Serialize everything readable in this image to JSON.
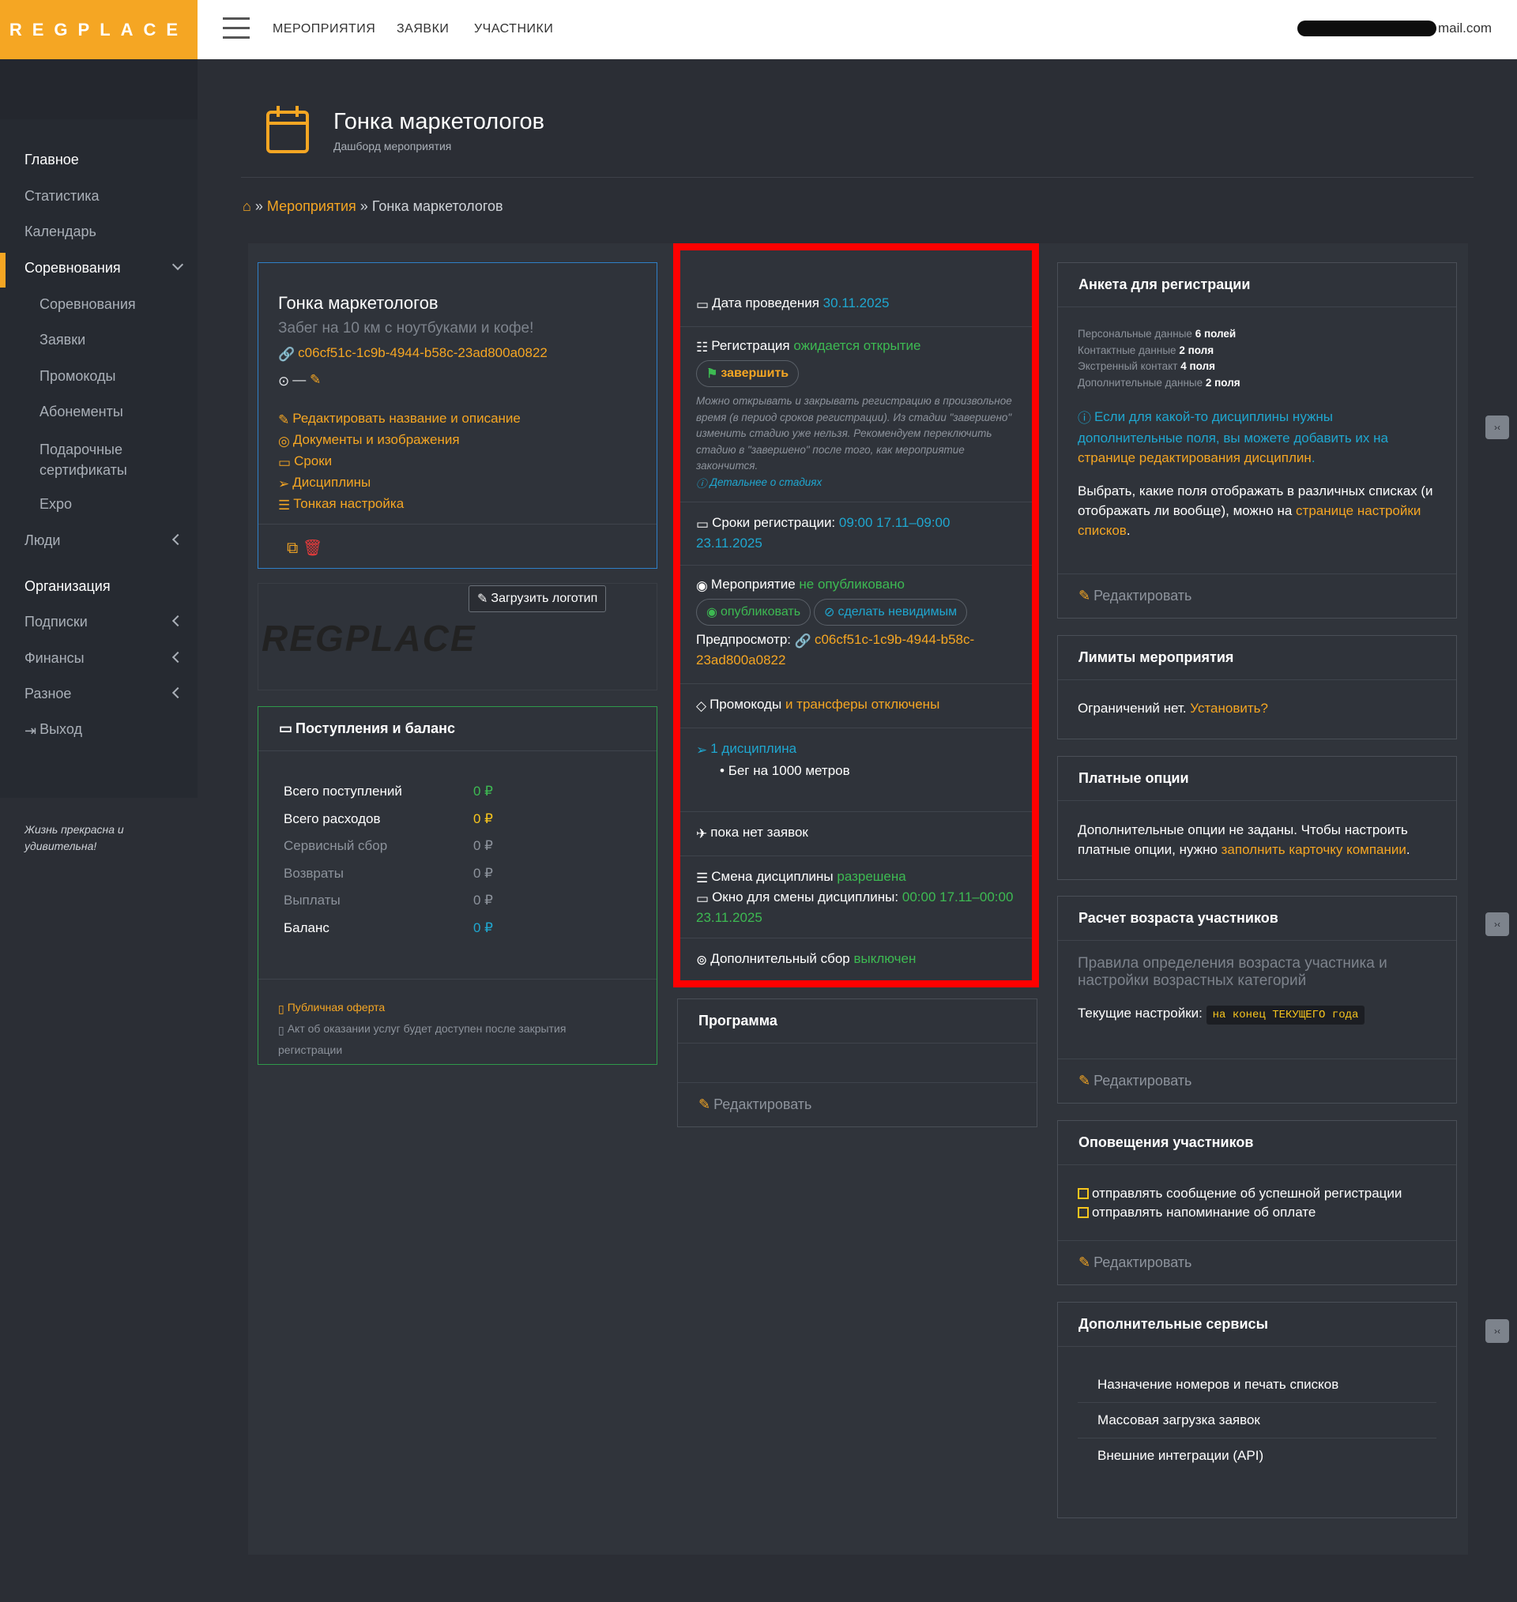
{
  "app": {
    "logo": "REGPLACE",
    "nav": [
      "МЕРОПРИЯТИЯ",
      "ЗАЯВКИ",
      "УЧАСТНИКИ"
    ],
    "email_suffix": "mail.com"
  },
  "sidebar": {
    "items": [
      {
        "label": "Главное"
      },
      {
        "label": "Статистика"
      },
      {
        "label": "Календарь"
      },
      {
        "label": "Соревнования"
      },
      {
        "label": "Соревнования"
      },
      {
        "label": "Заявки"
      },
      {
        "label": "Промокоды"
      },
      {
        "label": "Абонементы"
      },
      {
        "label": "Подарочные сертификаты"
      },
      {
        "label": "Expo"
      },
      {
        "label": "Люди"
      },
      {
        "label": "Организация"
      },
      {
        "label": "Подписки"
      },
      {
        "label": "Финансы"
      },
      {
        "label": "Разное"
      },
      {
        "label": "Выход"
      }
    ],
    "tagline": "Жизнь прекрасна и удивительна!"
  },
  "header": {
    "title": "Гонка маркетологов",
    "subtitle": "Дашборд мероприятия"
  },
  "breadcrumb": {
    "sep": "»",
    "link": "Мероприятия",
    "current": "Гонка маркетологов"
  },
  "event": {
    "title": "Гонка маркетологов",
    "desc": "Забег на 10 км с ноутбуками и кофе!",
    "id": "c06cf51c-1c9b-4944-b58c-23ad800a0822",
    "location": "—",
    "links": [
      "Редактировать название и описание",
      "Документы и изображения",
      "Сроки",
      "Дисциплины",
      "Тонкая настройка"
    ]
  },
  "logo_card": {
    "button": "Загрузить логотип",
    "image_text": "REGPLACE"
  },
  "finance": {
    "title": "Поступления и баланс",
    "rows": [
      {
        "label": "Всего поступлений",
        "value": "0 ₽"
      },
      {
        "label": "Всего расходов",
        "value": "0 ₽"
      },
      {
        "label": "Сервисный сбор",
        "value": "0 ₽"
      },
      {
        "label": "Возвраты",
        "value": "0 ₽"
      },
      {
        "label": "Выплаты",
        "value": "0 ₽"
      },
      {
        "label": "Баланс",
        "value": "0 ₽"
      }
    ],
    "offer": "Публичная оферта",
    "act": "Акт об оказании услуг будет доступен после закрытия регистрации"
  },
  "status": {
    "date_label": "Дата проведения",
    "date_value": "30.11.2025",
    "reg_label": "Регистрация",
    "reg_value": "ожидается открытие",
    "reg_button": "завершить",
    "reg_note": "Можно открывать и закрывать регистрацию в произвольное время (в период сроков регистрации). Из стадии \"завершено\" изменить стадию уже нельзя. Рекомендуем переключить стадию в \"завершено\" после того, как мероприятие закончится.",
    "reg_more": "Детальнее о стадиях",
    "period_label": "Сроки регистрации:",
    "period_value": "09:00 17.11–09:00 23.11.2025",
    "pub_label": "Мероприятие",
    "pub_value": "не опубликовано",
    "pub_btn1": "опубликовать",
    "pub_btn2": "сделать невидимым",
    "preview_label": "Предпросмотр:",
    "preview_value": "c06cf51c-1c9b-4944-b58c-23ad800a0822",
    "promo_label": "Промокоды",
    "promo_value": "и трансферы отключены",
    "disc_count": "1 дисциплина",
    "disc_item": "Бег на 1000 метров",
    "apps": "пока нет заявок",
    "change_label": "Смена дисциплины",
    "change_value": "разрешена",
    "window_label": "Окно для смены дисциплины:",
    "window_value": "00:00 17.11–00:00 23.11.2025",
    "fee_label": "Дополнительный сбор",
    "fee_value": "выключен"
  },
  "program": {
    "title": "Программа",
    "edit": "Редактировать"
  },
  "form": {
    "title": "Анкета для регистрации",
    "rows": [
      {
        "label": "Персональные данные",
        "value": "6 полей"
      },
      {
        "label": "Контактные данные",
        "value": "2 поля"
      },
      {
        "label": "Экстренный контакт",
        "value": "4 поля"
      },
      {
        "label": "Дополнительные данные",
        "value": "2 поля"
      }
    ],
    "info_pre": "Если для какой-то дисциплины нужны дополнительные поля, вы можете добавить их на",
    "info_link": "странице редактирования дисциплин",
    "lists_pre": "Выбрать, какие поля отображать в различных списках (и отображать ли вообще), можно на",
    "lists_link": "странице настройки списков",
    "edit": "Редактировать"
  },
  "limits": {
    "title": "Лимиты мероприятия",
    "text": "Ограничений нет.",
    "link": "Установить?"
  },
  "paid": {
    "title": "Платные опции",
    "text": "Дополнительные опции не заданы. Чтобы настроить платные опции, нужно",
    "link": "заполнить карточку компании"
  },
  "age": {
    "title": "Расчет возраста участников",
    "desc": "Правила определения возраста участника и настройки возрастных категорий",
    "cur_label": "Текущие настройки:",
    "cur_value": "на конец ТЕКУЩЕГО года",
    "edit": "Редактировать"
  },
  "notify": {
    "title": "Оповещения участников",
    "items": [
      "отправлять сообщение об успешной регистрации",
      "отправлять напоминание об оплате"
    ],
    "edit": "Редактировать"
  },
  "services": {
    "title": "Дополнительные сервисы",
    "items": [
      "Назначение номеров и печать списков",
      "Массовая загрузка заявок",
      "Внешние интеграции (API)"
    ]
  }
}
